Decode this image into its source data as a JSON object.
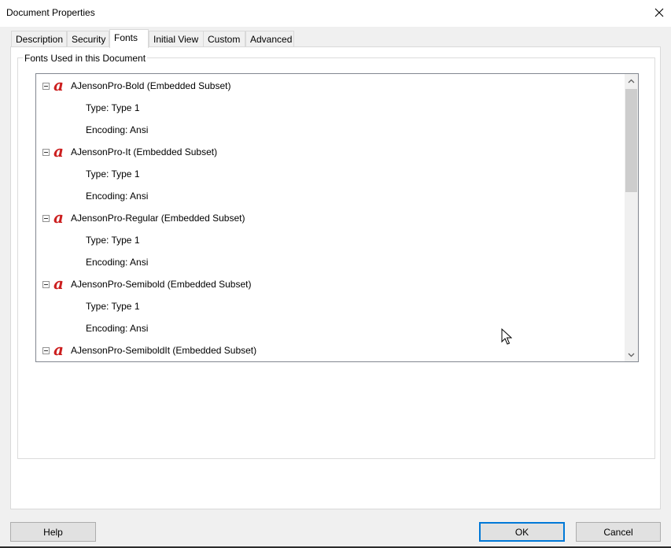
{
  "window": {
    "title": "Document Properties"
  },
  "tabs": [
    {
      "label": "Description",
      "active": false
    },
    {
      "label": "Security",
      "active": false
    },
    {
      "label": "Fonts",
      "active": true
    },
    {
      "label": "Initial View",
      "active": false
    },
    {
      "label": "Custom",
      "active": false
    },
    {
      "label": "Advanced",
      "active": false
    }
  ],
  "fonts_group": {
    "legend": "Fonts Used in this Document",
    "fonts": [
      {
        "name": "AJensonPro-Bold (Embedded Subset)",
        "type": "Type: Type 1",
        "encoding": "Encoding: Ansi"
      },
      {
        "name": "AJensonPro-It (Embedded Subset)",
        "type": "Type: Type 1",
        "encoding": "Encoding: Ansi"
      },
      {
        "name": "AJensonPro-Regular (Embedded Subset)",
        "type": "Type: Type 1",
        "encoding": "Encoding: Ansi"
      },
      {
        "name": "AJensonPro-Semibold (Embedded Subset)",
        "type": "Type: Type 1",
        "encoding": "Encoding: Ansi"
      },
      {
        "name": "AJensonPro-SemiboldIt (Embedded Subset)"
      }
    ]
  },
  "buttons": {
    "help": "Help",
    "ok": "OK",
    "cancel": "Cancel"
  },
  "colors": {
    "font_icon": "#cc1f1f",
    "accent": "#0078d7"
  },
  "icons": {
    "close": "close-icon",
    "font": "adobe-font-icon",
    "collapse": "collapse-toggle-icon"
  }
}
